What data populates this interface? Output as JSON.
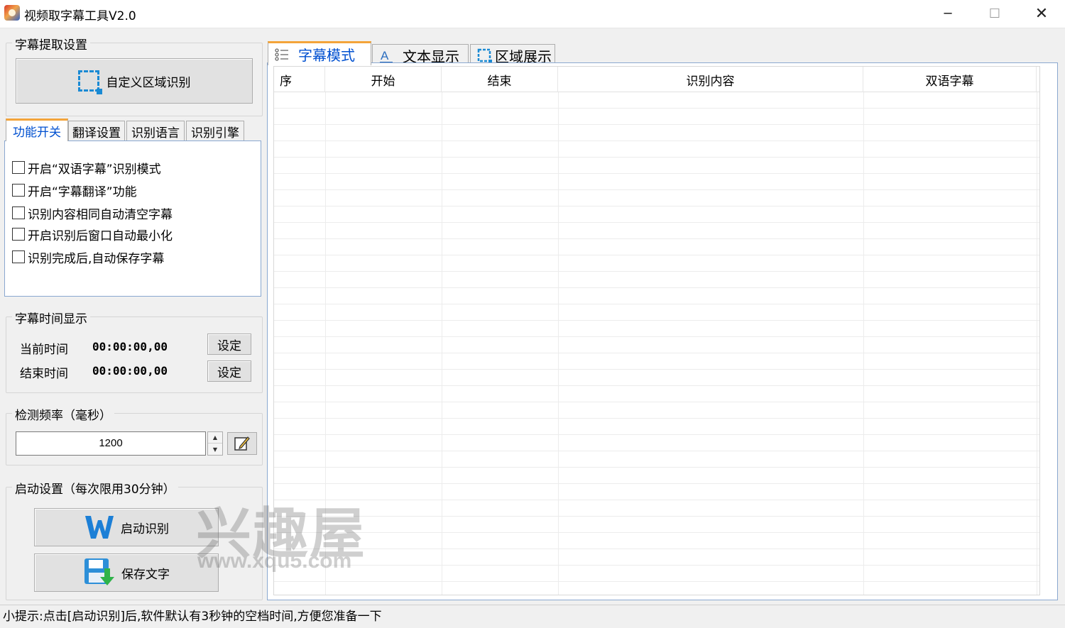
{
  "window": {
    "title": "视频取字幕工具V2.0",
    "minimize": "─",
    "maximize": "☐",
    "close": "✕"
  },
  "extract_settings": {
    "title": "字幕提取设置",
    "custom_region_button": "自定义区域识别"
  },
  "left_tabs": [
    "功能开关",
    "翻译设置",
    "识别语言",
    "识别引擎"
  ],
  "options": [
    "开启“双语字幕”识别模式",
    "开启“字幕翻译”功能",
    "识别内容相同自动清空字幕",
    "开启识别后窗口自动最小化",
    "识别完成后,自动保存字幕"
  ],
  "time_display": {
    "title": "字幕时间显示",
    "current_label": "当前时间",
    "current_value": "00:00:00,00",
    "end_label": "结束时间",
    "end_value": "00:00:00,00",
    "set_label": "设定"
  },
  "frequency": {
    "title": "检测频率（毫秒）",
    "value": "1200"
  },
  "startup": {
    "title": "启动设置（每次限用30分钟）",
    "start_button": "启动识别",
    "save_button": "保存文字"
  },
  "right_tabs": [
    "字幕模式",
    "文本显示",
    "区域展示"
  ],
  "table": {
    "columns": [
      "序",
      "开始",
      "结束",
      "识别内容",
      "双语字幕"
    ]
  },
  "watermark": {
    "big": "兴趣屋",
    "small": "www.xqu5.com"
  },
  "status_bar": "小提示:点击[启动识别]后,软件默认有3秒钟的空档时间,方便您准备一下",
  "colors": {
    "accent_blue": "#0050d0",
    "tab_highlight": "#f3a43a",
    "region_icon": "#1a8ad4"
  }
}
